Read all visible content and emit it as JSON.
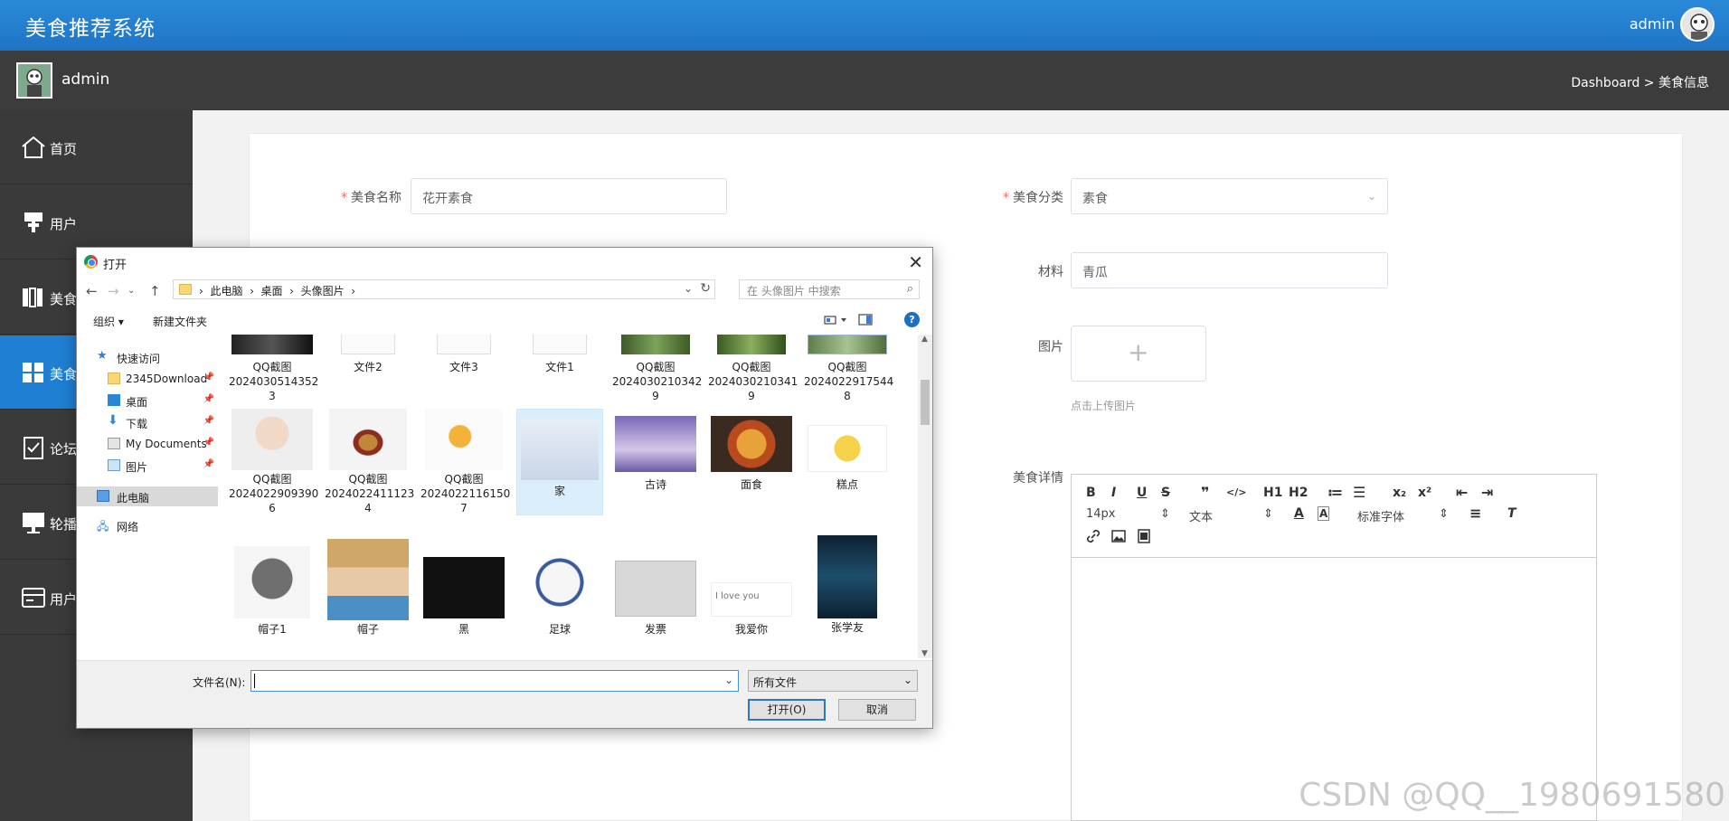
{
  "app": {
    "title": "美食推荐系统",
    "user": "admin"
  },
  "secbar": {
    "user": "admin",
    "breadcrumb": "Dashboard > 美食信息"
  },
  "sidebar": {
    "items": [
      {
        "label": "首页",
        "icon": "home-icon"
      },
      {
        "label": "用户",
        "icon": "user-icon"
      },
      {
        "label": "美食",
        "icon": "food-icon"
      },
      {
        "label": "美食",
        "icon": "grid-icon",
        "active": true
      },
      {
        "label": "论坛",
        "icon": "clipboard-icon"
      },
      {
        "label": "轮播",
        "icon": "monitor-icon"
      },
      {
        "label": "用户",
        "icon": "card-icon"
      }
    ]
  },
  "form": {
    "name_label": "美食名称",
    "name_value": "花开素食",
    "category_label": "美食分类",
    "category_value": "素食",
    "material_label": "材料",
    "material_value": "青瓜",
    "image_label": "图片",
    "upload_hint": "点击上传图片",
    "detail_label": "美食详情",
    "required_mark": "*"
  },
  "editor": {
    "font_size": "14px",
    "block_type": "文本",
    "font_family": "标准字体",
    "buttons": [
      "B",
      "I",
      "U",
      "S",
      "❞",
      "</>",
      "H1",
      "H2",
      "≔",
      "☰",
      "x₂",
      "x²"
    ]
  },
  "watermark": "CSDN @QQ__1980691580",
  "dialog": {
    "title": "打开",
    "path": [
      "此电脑",
      "桌面",
      "头像图片"
    ],
    "search_placeholder": "在 头像图片 中搜索",
    "organize": "组织 ▾",
    "new_folder": "新建文件夹",
    "help": "?",
    "nav": [
      {
        "label": "快速访问",
        "icon": "star-icon"
      },
      {
        "label": "2345Download",
        "icon": "folder-icon",
        "pinned": true
      },
      {
        "label": "桌面",
        "icon": "desktop-icon",
        "pinned": true
      },
      {
        "label": "下载",
        "icon": "download-icon",
        "pinned": true
      },
      {
        "label": "My Documents",
        "icon": "documents-icon",
        "pinned": true
      },
      {
        "label": "图片",
        "icon": "pictures-icon",
        "pinned": true
      },
      {
        "label": "此电脑",
        "icon": "computer-icon",
        "selected": true
      },
      {
        "label": "网络",
        "icon": "network-icon"
      }
    ],
    "files": [
      {
        "name": "QQ截图\n2024030514352\n3"
      },
      {
        "name": "文件2"
      },
      {
        "name": "文件3"
      },
      {
        "name": "文件1"
      },
      {
        "name": "QQ截图\n2024030210342\n9"
      },
      {
        "name": "QQ截图\n2024030210341\n9"
      },
      {
        "name": "QQ截图\n2024022917544\n8"
      },
      {
        "name": "QQ截图\n2024022909390\n6"
      },
      {
        "name": "QQ截图\n2024022411123\n4"
      },
      {
        "name": "QQ截图\n2024022116150\n7"
      },
      {
        "name": "家",
        "selected": true
      },
      {
        "name": "古诗"
      },
      {
        "name": "面食"
      },
      {
        "name": "糕点"
      },
      {
        "name": "帽子1"
      },
      {
        "name": "帽子"
      },
      {
        "name": "黑"
      },
      {
        "name": "足球"
      },
      {
        "name": "发票"
      },
      {
        "name": "我爱你"
      },
      {
        "name": "张学友"
      }
    ],
    "love_you_text": "I love you",
    "filename_label": "文件名(N):",
    "filename_value": "",
    "filetype": "所有文件",
    "open_button": "打开(O)",
    "cancel_button": "取消"
  }
}
